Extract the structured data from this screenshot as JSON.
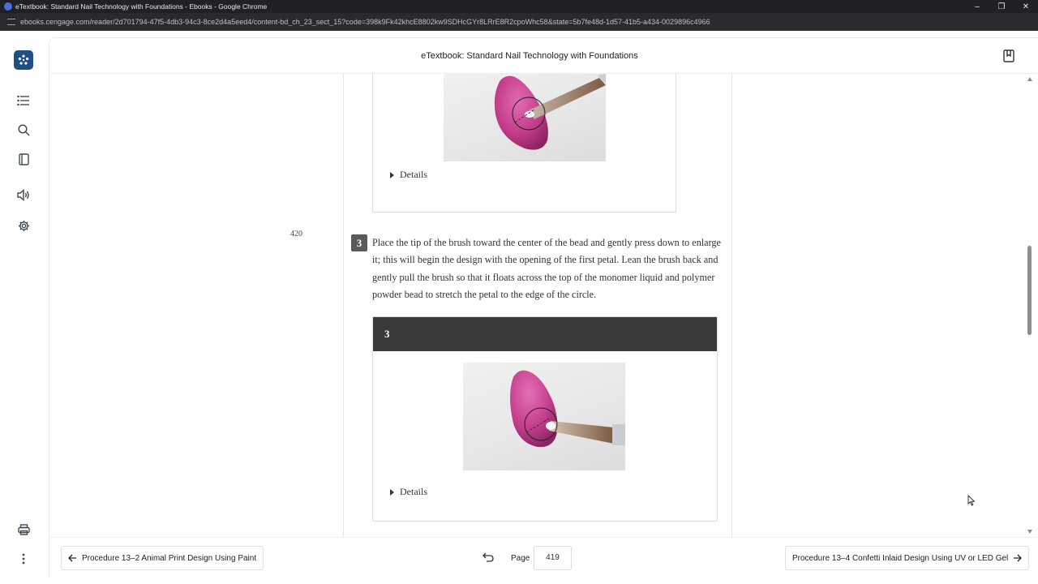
{
  "browser": {
    "window_title": "eTextbook: Standard Nail Technology with Foundations - Ebooks - Google Chrome",
    "url": "ebooks.cengage.com/reader/2d701794-47f5-4db3-94c3-8ce2d4a5eed4/content-bd_ch_23_sect_15?code=398k9Fk42khcE8802kw9SDHcGYr8LRrE8R2cpoWhc58&state=5b7fe48d-1d57-41b5-a434-0029896c4966"
  },
  "header": {
    "title": "eTextbook: Standard Nail Technology with Foundations"
  },
  "content": {
    "page_marker": "420",
    "figure1": {
      "details_label": "Details"
    },
    "step": {
      "number": "3",
      "text": "Place the tip of the brush toward the center of the bead and gently press down to enlarge it; this will begin the design with the opening of the first petal. Lean the brush back and gently pull the brush so that it floats across the top of the monomer liquid and polymer powder bead to stretch the petal to the edge of the circle."
    },
    "figure2": {
      "header": "3",
      "details_label": "Details"
    }
  },
  "footer": {
    "prev_label": "Procedure 13–2 Animal Print Design Using Paint",
    "next_label": "Procedure 13–4 Confetti Inlaid Design Using UV or LED Gel",
    "page_label": "Page",
    "page_value": "419"
  },
  "colors": {
    "brand": "#1f4f85",
    "figure_header_bg": "#3a3a3a",
    "nail_pink": "#c43d8c"
  }
}
